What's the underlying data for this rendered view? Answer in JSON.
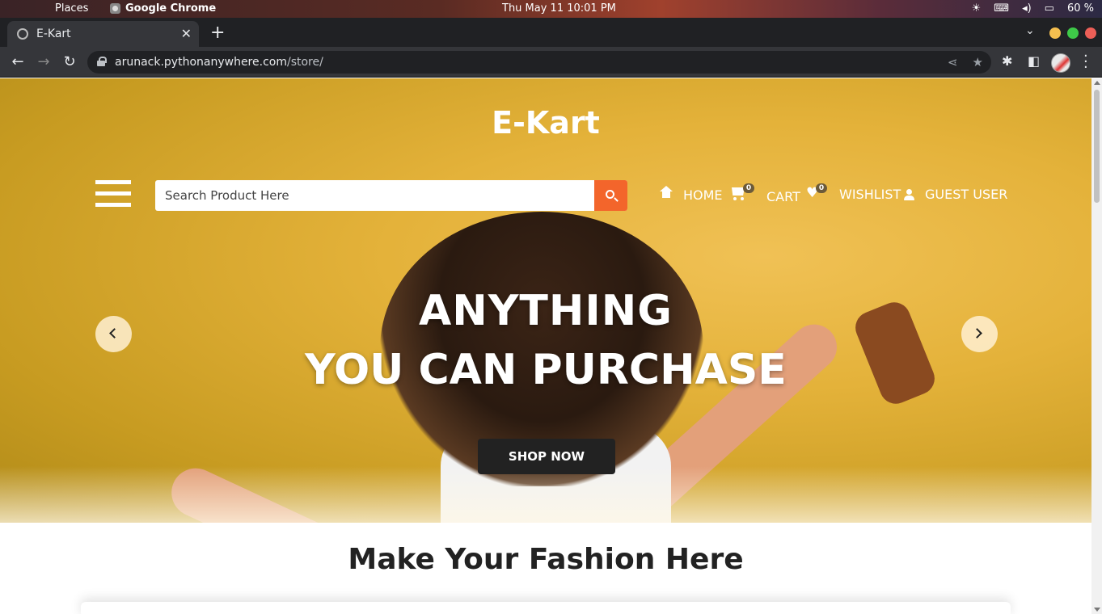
{
  "system": {
    "menu_places": "Places",
    "active_app": "Google Chrome",
    "clock": "Thu May 11  10:01 PM",
    "battery": "60 %"
  },
  "browser": {
    "tab_title": "E-Kart",
    "url_host": "arunack.pythonanywhere.com",
    "url_path": "/store/",
    "window_controls": [
      "#f5bf4f",
      "#3ec948",
      "#ed5f57"
    ]
  },
  "site": {
    "brand": "E-Kart",
    "search": {
      "placeholder": "Search Product Here"
    },
    "nav": {
      "home": "HOME",
      "cart": "CART",
      "cart_count": "0",
      "wishlist": "WISHLIST",
      "wishlist_count": "0",
      "user": "GUEST USER"
    },
    "hero": {
      "line1": "ANYTHING",
      "line2": "YOU CAN PURCHASE",
      "cta": "SHOP NOW"
    },
    "section_title": "Make Your Fashion Here",
    "colors": {
      "accent": "#f3652b",
      "hero_bg": "#e4b23a",
      "cta_bg": "#222222"
    }
  }
}
